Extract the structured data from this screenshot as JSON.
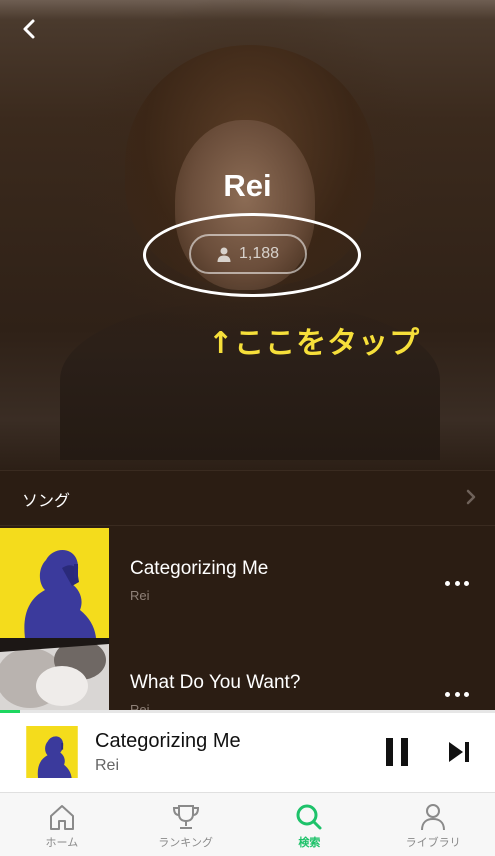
{
  "artist": {
    "name": "Rei",
    "followers": "1,188"
  },
  "annotation": {
    "text": "↑ここをタップ",
    "color": "#f6df3a"
  },
  "section": {
    "title": "ソング"
  },
  "songs": [
    {
      "title": "Categorizing Me",
      "artist": "Rei"
    },
    {
      "title": "What Do You Want?",
      "artist": "Rei"
    }
  ],
  "player": {
    "title": "Categorizing Me",
    "artist": "Rei",
    "progress": 0.04,
    "state": "playing"
  },
  "tabs": [
    {
      "label": "ホーム",
      "icon": "home-icon"
    },
    {
      "label": "ランキング",
      "icon": "trophy-icon"
    },
    {
      "label": "検索",
      "icon": "search-icon",
      "active": true
    },
    {
      "label": "ライブラリ",
      "icon": "person-icon"
    }
  ],
  "colors": {
    "accent": "#1ec26a",
    "background": "#2b1d13"
  }
}
